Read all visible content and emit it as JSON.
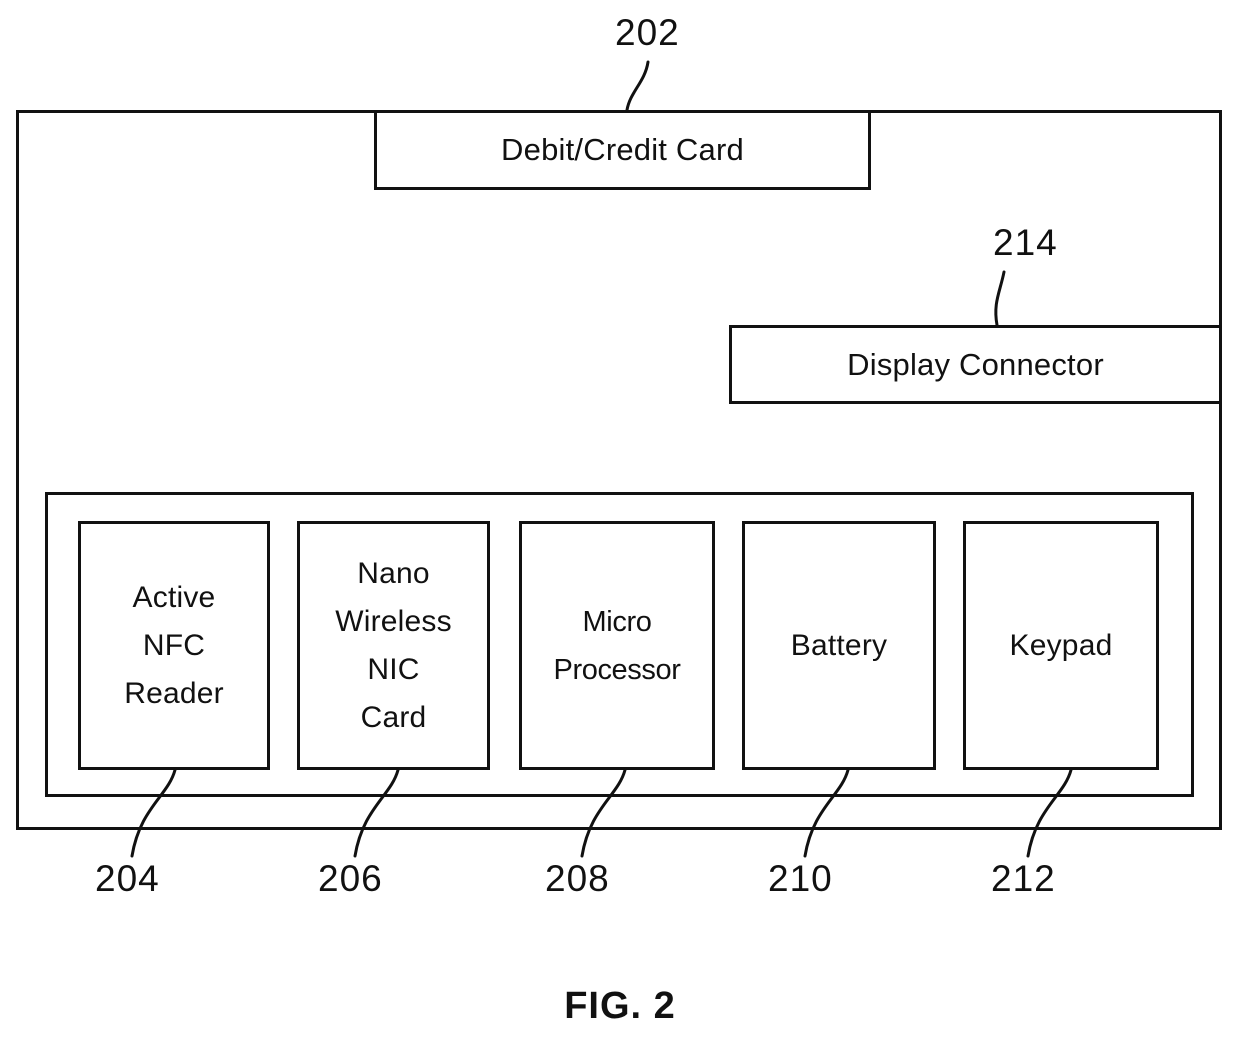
{
  "figure": {
    "caption": "FIG. 2"
  },
  "outer_container": {
    "ref": "202"
  },
  "blocks": {
    "debit_credit_card": {
      "label": "Debit/Credit Card"
    },
    "display_connector": {
      "label": "Display Connector",
      "ref": "214"
    }
  },
  "components": [
    {
      "label": "Active\nNFC\nReader",
      "ref": "204"
    },
    {
      "label": "Nano\nWireless\nNIC\nCard",
      "ref": "206"
    },
    {
      "label": "Micro\nProcessor",
      "ref": "208"
    },
    {
      "label": "Battery",
      "ref": "210"
    },
    {
      "label": "Keypad",
      "ref": "212"
    }
  ],
  "colors": {
    "line": "#111111",
    "background": "#ffffff"
  }
}
